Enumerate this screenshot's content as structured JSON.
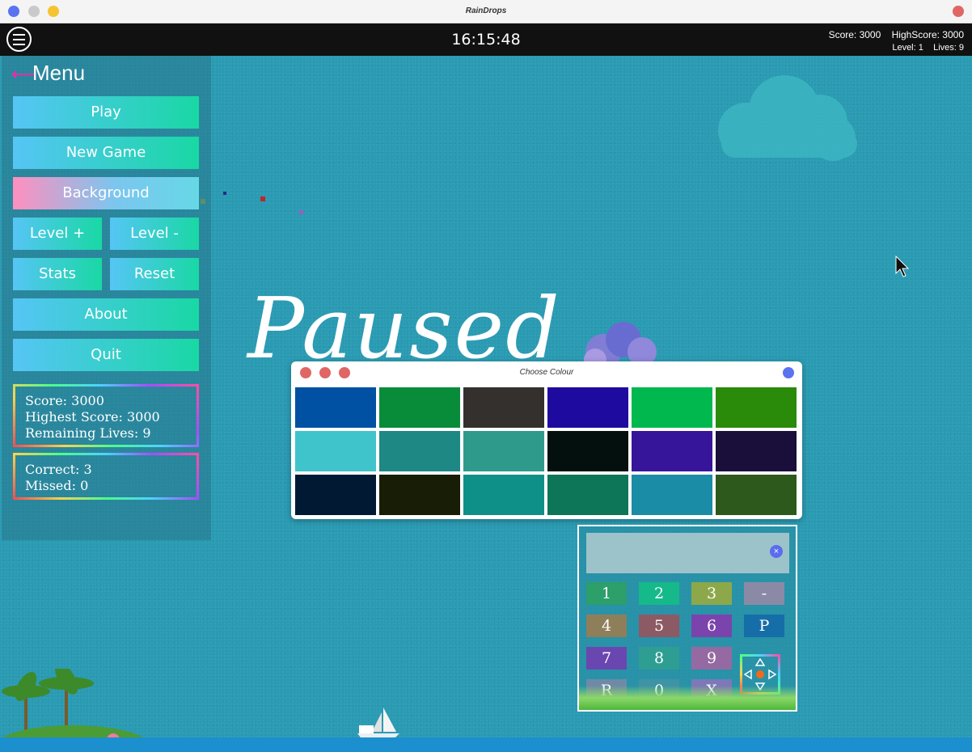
{
  "window": {
    "title": "RainDrops"
  },
  "hud": {
    "clock": "16:15:48",
    "score_line": "Score: 3000    HighScore: 3000",
    "level_line": "Level: 1    Lives: 9"
  },
  "menu": {
    "title": "Menu",
    "play": "Play",
    "new_game": "New Game",
    "background": "Background",
    "level_up": "Level +",
    "level_down": "Level -",
    "stats": "Stats",
    "reset": "Reset",
    "about": "About",
    "quit": "Quit"
  },
  "stats": {
    "score": "Score: 3000",
    "highest": "Highest Score: 3000",
    "lives": "Remaining Lives: 9",
    "correct": "Correct: 3",
    "missed": "Missed: 0"
  },
  "paused_text": "Paused",
  "colour_dialog": {
    "title": "Choose Colour",
    "swatches": [
      "#0050a4",
      "#098c3a",
      "#33302d",
      "#1f0aa0",
      "#00b84e",
      "#2a8a0a",
      "#40c4cc",
      "#1e8885",
      "#2e9a8c",
      "#03100e",
      "#36159a",
      "#1a0f3a",
      "#021934",
      "#181d06",
      "#0e9088",
      "#0d7658",
      "#1a8ca6",
      "#2d5a1c"
    ]
  },
  "keypad": {
    "clear": "×",
    "keys": [
      "1",
      "2",
      "3",
      "-",
      "4",
      "5",
      "6",
      "P",
      "7",
      "8",
      "9",
      "R",
      "0",
      "X"
    ]
  }
}
